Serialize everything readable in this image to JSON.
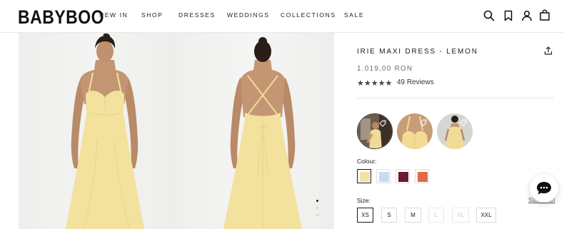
{
  "brand": {
    "logo": "BABYBOO"
  },
  "nav": {
    "items": [
      "NEW IN",
      "SHOP",
      "DRESSES",
      "WEDDINGS",
      "COLLECTIONS",
      "SALE"
    ]
  },
  "header_icons": [
    "search-icon",
    "bookmark-icon",
    "account-icon",
    "bag-icon"
  ],
  "gallery": {
    "images": [
      "dress-front-photo",
      "dress-back-photo"
    ],
    "active_dot": 0,
    "dot_count": 3,
    "dress_color": "#f3e19e"
  },
  "product": {
    "title": "IRIE MAXI DRESS - LEMON",
    "price": "1.019,00 RON",
    "rating_stars": "★★★★★",
    "reviews_label": "49 Reviews"
  },
  "thumbnails": [
    {
      "name": "photo-thumbnail-1",
      "selected": true
    },
    {
      "name": "photo-thumbnail-2",
      "selected": false
    },
    {
      "name": "photo-thumbnail-3",
      "selected": false
    }
  ],
  "colour": {
    "label": "Colour:",
    "swatches": [
      {
        "name": "lemon",
        "hex": "#f3e2a6",
        "selected": true
      },
      {
        "name": "light-blue",
        "hex": "#c9dcea",
        "selected": false
      },
      {
        "name": "burgundy",
        "hex": "#6e1a2e",
        "selected": false
      },
      {
        "name": "orange",
        "hex": "#df6b47",
        "selected": false
      }
    ]
  },
  "size": {
    "label": "Size:",
    "chart_link": "Size Chart",
    "options": [
      {
        "label": "XS",
        "selected": true,
        "disabled": false
      },
      {
        "label": "S",
        "selected": false,
        "disabled": false
      },
      {
        "label": "M",
        "selected": false,
        "disabled": false
      },
      {
        "label": "L",
        "selected": false,
        "disabled": true
      },
      {
        "label": "XL",
        "selected": false,
        "disabled": true
      },
      {
        "label": "XXL",
        "selected": false,
        "disabled": false
      }
    ]
  },
  "chat": {
    "icon": "chat-icon"
  }
}
